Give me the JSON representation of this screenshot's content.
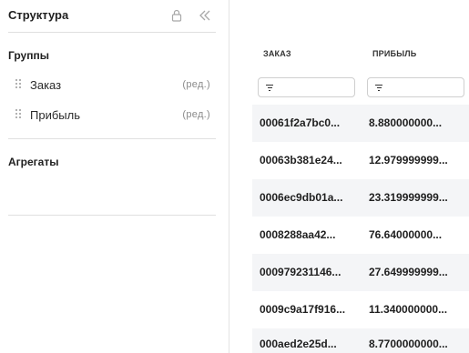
{
  "sidebar": {
    "title": "Структура",
    "groups_title": "Группы",
    "groups": [
      {
        "label": "Заказ",
        "edit": "(ред.)"
      },
      {
        "label": "Прибыль",
        "edit": "(ред.)"
      }
    ],
    "aggregates_title": "Агрегаты"
  },
  "grid": {
    "columns": [
      "ЗАКАЗ",
      "ПРИБЫЛЬ"
    ],
    "rows": [
      [
        "00061f2a7bc0...",
        "8.880000000..."
      ],
      [
        "00063b381e24...",
        "12.979999999..."
      ],
      [
        "0006ec9db01a...",
        "23.319999999..."
      ],
      [
        "0008288aa42...",
        "76.64000000..."
      ],
      [
        "000979231146...",
        "27.649999999..."
      ],
      [
        "0009c9a17f916...",
        "11.340000000..."
      ],
      [
        "000aed2e25d...",
        "8.7700000000..."
      ]
    ]
  }
}
